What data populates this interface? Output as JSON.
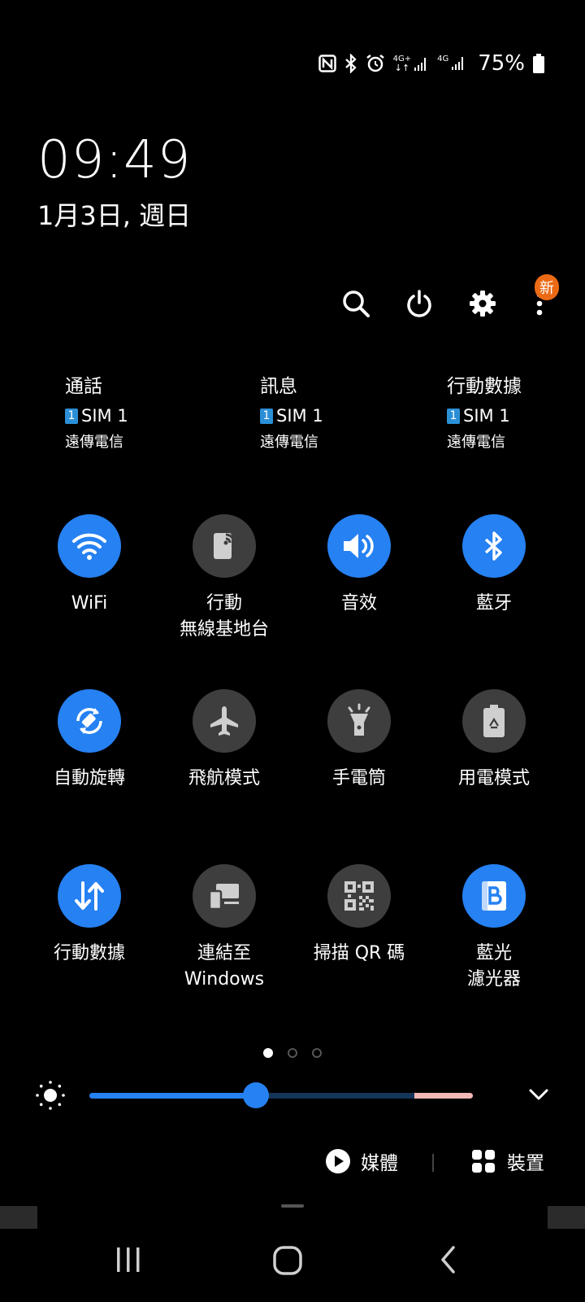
{
  "status_bar": {
    "icons": [
      "nfc-icon",
      "bluetooth-icon",
      "alarm-icon",
      "signal-4g-plus-icon",
      "signal-4g-icon",
      "battery-icon"
    ],
    "net_label_1": "4G+",
    "net_label_2": "4G",
    "battery_percent": "75%"
  },
  "clock": {
    "time": "09:49",
    "date": "1月3日, 週日"
  },
  "top_actions": {
    "new_badge": "新"
  },
  "sim_settings": [
    {
      "title": "通話",
      "sim": "SIM 1",
      "sim_num": "1",
      "carrier": "遠傳電信"
    },
    {
      "title": "訊息",
      "sim": "SIM 1",
      "sim_num": "1",
      "carrier": "遠傳電信"
    },
    {
      "title": "行動數據",
      "sim": "SIM 1",
      "sim_num": "1",
      "carrier": "遠傳電信"
    }
  ],
  "tiles": [
    {
      "label_1": "WiFi",
      "label_2": "",
      "on": true,
      "icon": "wifi-icon"
    },
    {
      "label_1": "行動",
      "label_2": "無線基地台",
      "on": false,
      "icon": "hotspot-icon"
    },
    {
      "label_1": "音效",
      "label_2": "",
      "on": true,
      "icon": "sound-icon"
    },
    {
      "label_1": "藍牙",
      "label_2": "",
      "on": true,
      "icon": "bluetooth-icon"
    },
    {
      "label_1": "自動旋轉",
      "label_2": "",
      "on": true,
      "icon": "auto-rotate-icon"
    },
    {
      "label_1": "飛航模式",
      "label_2": "",
      "on": false,
      "icon": "airplane-icon"
    },
    {
      "label_1": "手電筒",
      "label_2": "",
      "on": false,
      "icon": "flashlight-icon"
    },
    {
      "label_1": "用電模式",
      "label_2": "",
      "on": false,
      "icon": "power-mode-icon"
    },
    {
      "label_1": "行動數據",
      "label_2": "",
      "on": true,
      "icon": "mobile-data-icon"
    },
    {
      "label_1": "連結至",
      "label_2": "Windows",
      "on": false,
      "icon": "link-to-windows-icon"
    },
    {
      "label_1": "掃描 QR 碼",
      "label_2": "",
      "on": false,
      "icon": "qr-scan-icon"
    },
    {
      "label_1": "藍光",
      "label_2": "濾光器",
      "on": true,
      "icon": "blue-light-filter-icon"
    }
  ],
  "pager": {
    "pages": 3,
    "active": 0
  },
  "brightness": {
    "level": 0.435
  },
  "bottom": {
    "media_label": "媒體",
    "devices_label": "裝置"
  },
  "colors": {
    "accent": "#2681f2",
    "tile_off": "#3e3e3e",
    "badge": "#ec6a16",
    "warn": "#f1b8b6"
  }
}
